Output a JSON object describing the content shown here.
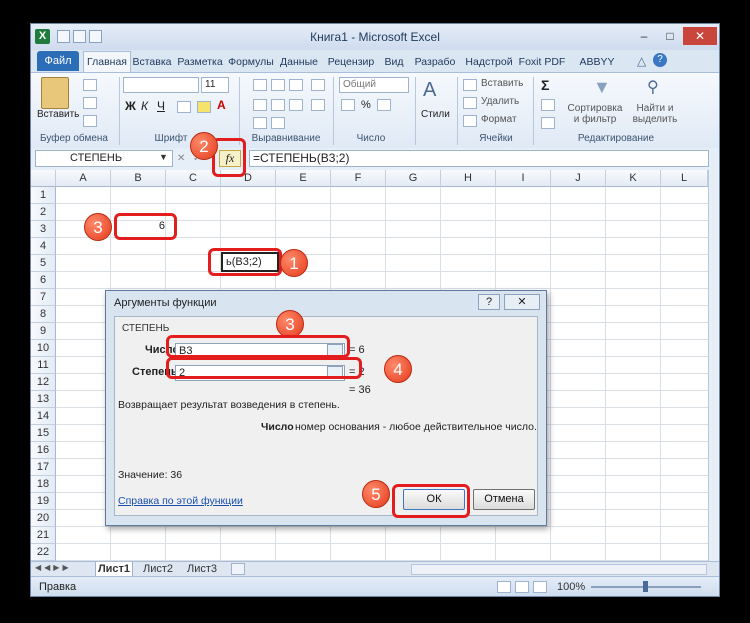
{
  "window": {
    "title": "Книга1 - Microsoft Excel"
  },
  "tabs": [
    "Главная",
    "Вставка",
    "Разметка",
    "Формулы",
    "Данные",
    "Рецензир",
    "Вид",
    "Разрабо",
    "Надстрой",
    "Foxit PDF",
    "ABBYY PDF"
  ],
  "file_tab": "Файл",
  "ribbon": {
    "paste": "Вставить",
    "clipboard": "Буфер обмена",
    "font_group": "Шрифт",
    "font_size": "11",
    "align_group": "Выравнивание",
    "number_group": "Число",
    "number_format": "Общий",
    "styles": "Стили",
    "cells_group": "Ячейки",
    "insert": "Вставить",
    "delete": "Удалить",
    "format": "Формат",
    "sort": "Сортировка\nи фильтр",
    "find": "Найти и\nвыделить",
    "editing_group": "Редактирование"
  },
  "formula_bar": {
    "name_box": "СТЕПЕНЬ",
    "fx": "fx",
    "formula": "=СТЕПЕНЬ(B3;2)"
  },
  "columns": [
    "A",
    "B",
    "C",
    "D",
    "E",
    "F",
    "G",
    "H",
    "I",
    "J",
    "K",
    "L"
  ],
  "rows": [
    "1",
    "2",
    "3",
    "4",
    "5",
    "6",
    "7",
    "8",
    "9",
    "10",
    "11",
    "12",
    "13",
    "14",
    "15",
    "16",
    "17",
    "18",
    "19",
    "20",
    "21",
    "22"
  ],
  "cells": {
    "B3": "6",
    "D5": "ь(B3;2)"
  },
  "dialog": {
    "title": "Аргументы функции",
    "help_btn": "?",
    "close_btn": "✕",
    "func_name": "СТЕПЕНЬ",
    "arg1_label": "Число",
    "arg1_value": "B3",
    "arg1_result": "= 6",
    "arg2_label": "Степень",
    "arg2_value": "2",
    "arg2_result": "= 2",
    "total_result": "= 36",
    "description": "Возвращает результат возведения в степень.",
    "arg_desc_name": "Число",
    "arg_desc_text": "номер основания - любое действительное число.",
    "value_line": "Значение:  36",
    "help_link": "Справка по этой функции",
    "ok": "ОК",
    "cancel": "Отмена"
  },
  "callouts": [
    "3",
    "2",
    "3",
    "1",
    "3",
    "4",
    "5"
  ],
  "sheets": [
    "Лист1",
    "Лист2",
    "Лист3"
  ],
  "status": {
    "mode": "Правка",
    "zoom": "100%"
  },
  "colors": {
    "accent": "#e31d1d",
    "file_tab": "#2c6db8"
  }
}
